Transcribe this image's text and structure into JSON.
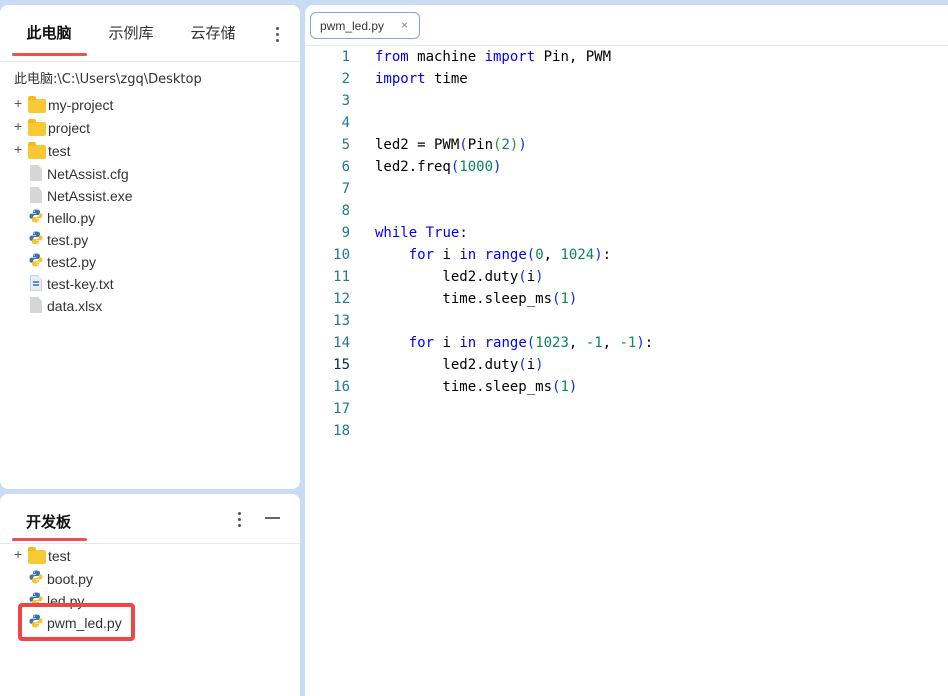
{
  "files_panel": {
    "tabs": [
      "此电脑",
      "示例库",
      "云存储"
    ],
    "active_tab": "此电脑",
    "path": "此电脑:\\C:\\Users\\zgq\\Desktop",
    "items": [
      {
        "name": "my-project",
        "type": "folder",
        "icon": "folder-icon"
      },
      {
        "name": "project",
        "type": "folder",
        "icon": "folder-icon"
      },
      {
        "name": "test",
        "type": "folder",
        "icon": "folder-icon"
      },
      {
        "name": "NetAssist.cfg",
        "type": "file",
        "icon": "file-icon"
      },
      {
        "name": "NetAssist.exe",
        "type": "file",
        "icon": "file-icon"
      },
      {
        "name": "hello.py",
        "type": "python",
        "icon": "python-icon"
      },
      {
        "name": "test.py",
        "type": "python",
        "icon": "python-icon"
      },
      {
        "name": "test2.py",
        "type": "python",
        "icon": "python-icon"
      },
      {
        "name": "test-key.txt",
        "type": "text",
        "icon": "text-file-icon"
      },
      {
        "name": "data.xlsx",
        "type": "file",
        "icon": "file-icon"
      }
    ]
  },
  "board_panel": {
    "title": "开发板",
    "items": [
      {
        "name": "test",
        "type": "folder",
        "icon": "folder-icon"
      },
      {
        "name": "boot.py",
        "type": "python",
        "icon": "python-icon"
      },
      {
        "name": "led.py",
        "type": "python",
        "icon": "python-icon"
      },
      {
        "name": "pwm_led.py",
        "type": "python",
        "icon": "python-icon",
        "highlighted": true
      }
    ]
  },
  "editor": {
    "open_tab": "pwm_led.py",
    "close_glyph": "×",
    "current_line": 15,
    "lines": [
      "from machine import Pin, PWM",
      "import time",
      "",
      "",
      "led2 = PWM(Pin(2))",
      "led2.freq(1000)",
      "",
      "",
      "while True:",
      "    for i in range(0, 1024):",
      "        led2.duty(i)",
      "        time.sleep_ms(1)",
      "",
      "    for i in range(1023, -1, -1):",
      "        led2.duty(i)",
      "        time.sleep_ms(1)",
      "",
      ""
    ]
  },
  "colors": {
    "accent_underline": "#e55353",
    "highlight_border": "#f04545",
    "keyword": "#0000ff",
    "number": "#098658",
    "line_number": "#237893"
  }
}
